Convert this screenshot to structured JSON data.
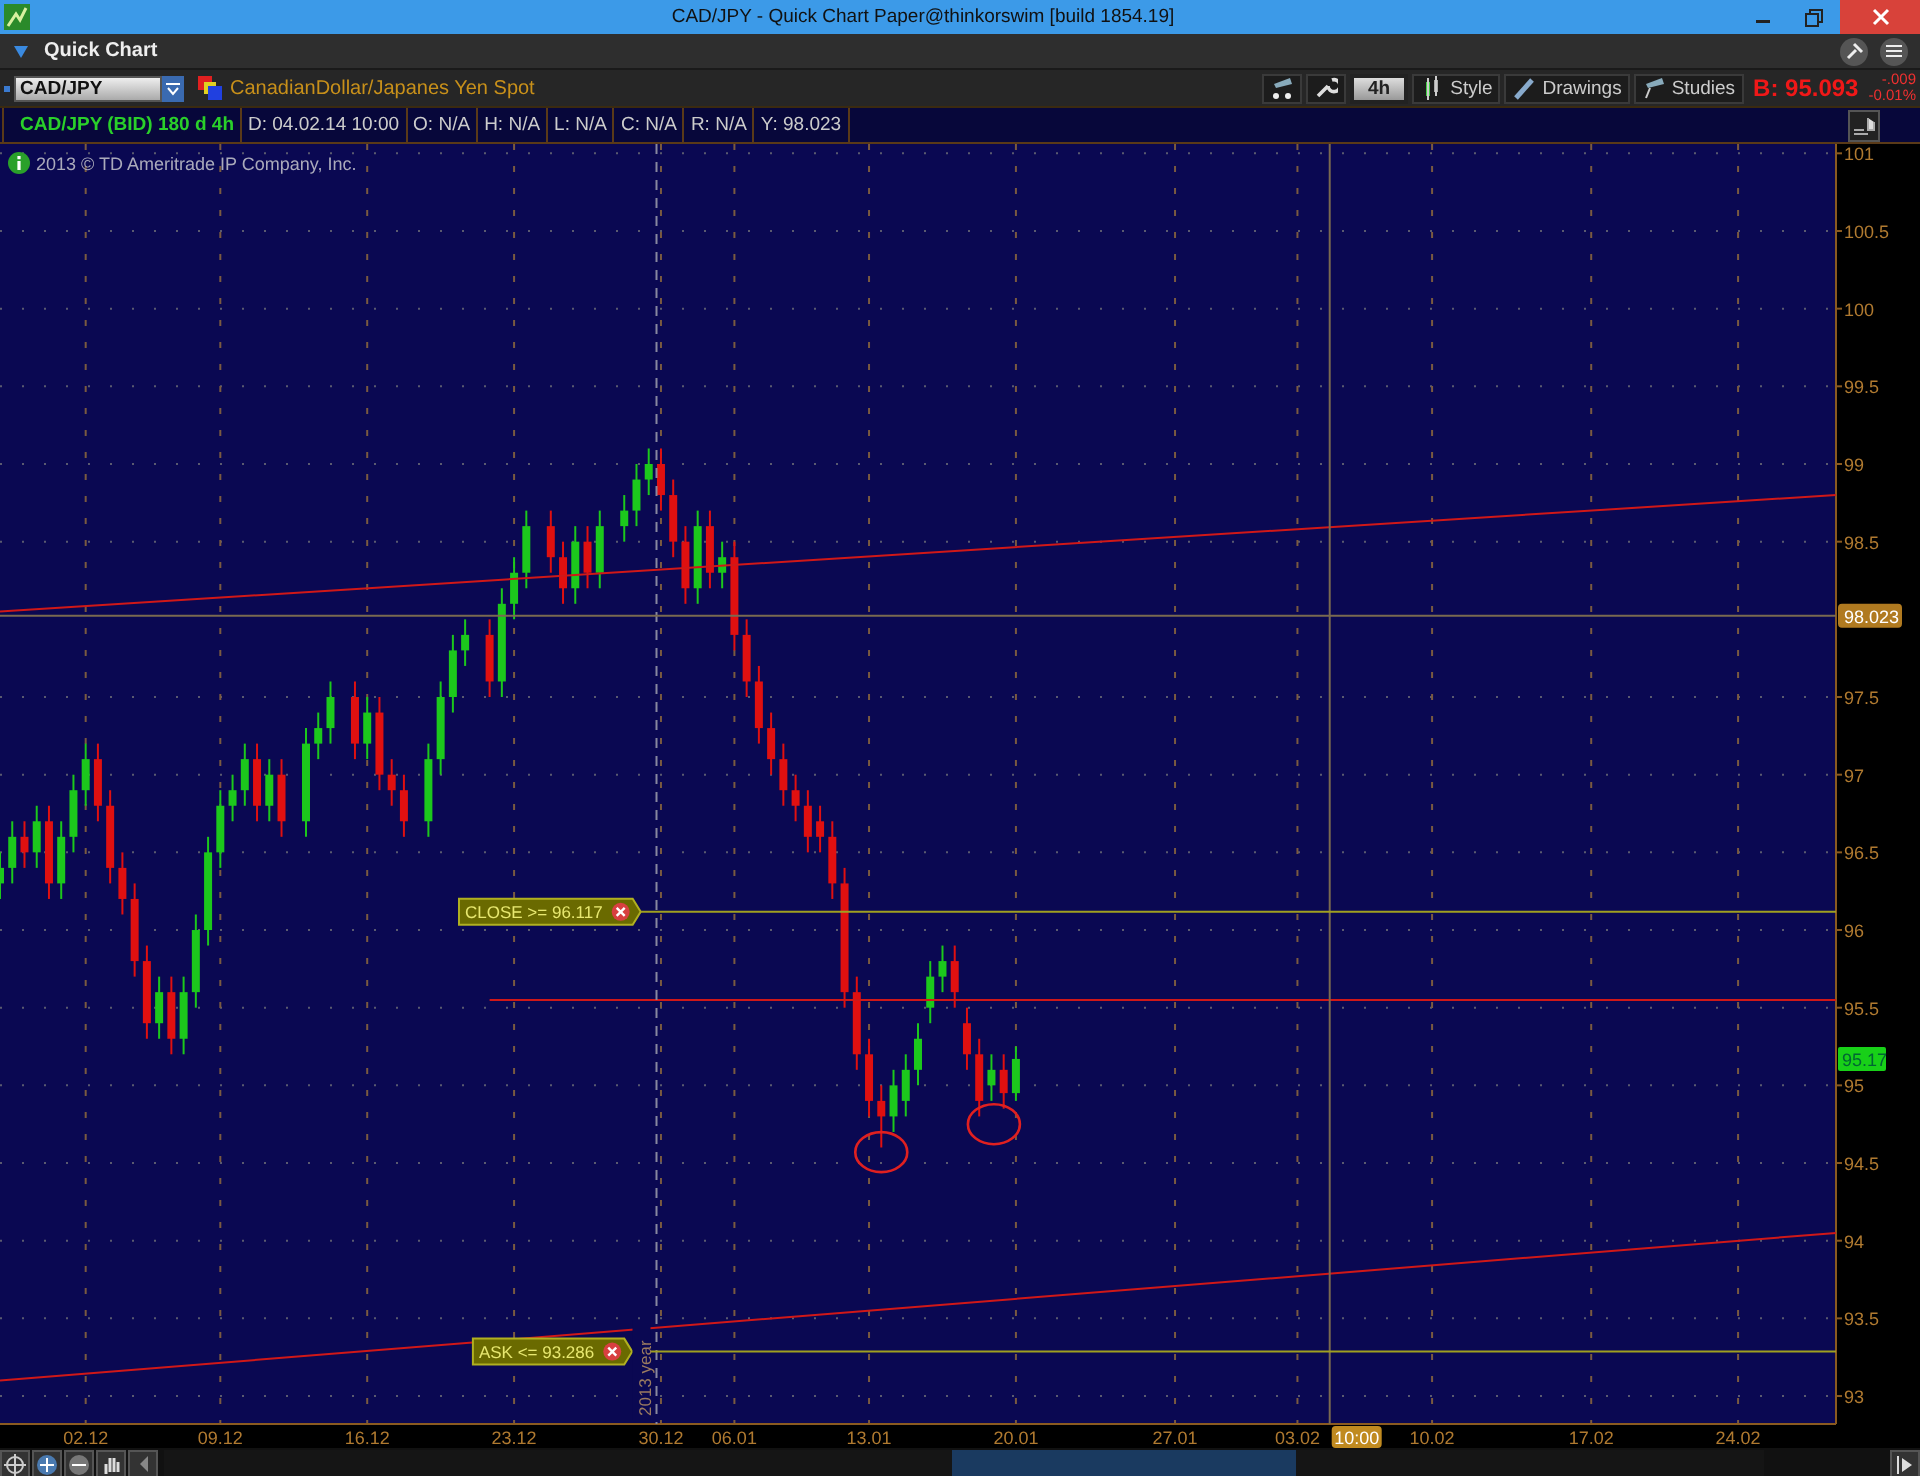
{
  "window": {
    "title": "CAD/JPY - Quick Chart Paper@thinkorswim [build 1854.19]"
  },
  "panel": {
    "title": "Quick Chart"
  },
  "toolbar": {
    "symbol": "CAD/JPY",
    "description": "CanadianDollar/Japanes Yen Spot",
    "timeframe": "4h",
    "buttons": [
      "Style",
      "Drawings",
      "Studies"
    ],
    "bid": "B: 95.093",
    "change": "-.009",
    "change_percent": "-0.01%"
  },
  "info_row": [
    "CAD/JPY (BID) 180 d 4h",
    "D: 04.02.14 10:00",
    "O: N/A",
    "H: N/A",
    "L: N/A",
    "C: N/A",
    "R: N/A",
    "Y: 98.023"
  ],
  "copyright": "2013 © TD Ameritrade IP Company, Inc.",
  "chart_data": {
    "type": "candlestick",
    "grid": true,
    "ylim": [
      92.82,
      101.06
    ],
    "yticks": [
      93,
      93.5,
      94,
      94.5,
      95,
      95.5,
      96,
      96.5,
      97,
      97.5,
      98.5,
      99,
      99.5,
      100,
      100.5,
      101
    ],
    "categories": [
      null,
      null,
      null,
      null,
      null,
      null,
      null,
      "02.12",
      null,
      null,
      null,
      null,
      null,
      null,
      null,
      null,
      null,
      null,
      "09.12",
      null,
      null,
      null,
      null,
      null,
      null,
      null,
      null,
      null,
      null,
      null,
      "16.12",
      null,
      null,
      null,
      null,
      null,
      null,
      null,
      null,
      null,
      null,
      null,
      "23.12",
      null,
      null,
      null,
      null,
      null,
      null,
      null,
      null,
      null,
      null,
      null,
      "30.12",
      null,
      null,
      null,
      null,
      null,
      "06.01",
      null,
      null,
      null,
      null,
      null,
      null,
      null,
      null,
      null,
      null,
      "13.01",
      null,
      null,
      null,
      null,
      null,
      null,
      null,
      null,
      null,
      null,
      null,
      "20.01",
      null,
      null,
      null,
      null,
      null,
      null,
      null,
      null,
      null,
      null,
      null,
      null,
      "27.01",
      null,
      null,
      null,
      null,
      null,
      null,
      null,
      null,
      null,
      "03.02",
      null,
      null,
      null,
      null,
      null,
      null,
      null,
      null,
      null,
      null,
      "10.02",
      null,
      null,
      null,
      null,
      null,
      null,
      null,
      null,
      null,
      null,
      null,
      null,
      "17.02",
      null,
      null,
      null,
      null,
      null,
      null,
      null,
      null,
      null,
      null,
      null,
      "24.02",
      null,
      null,
      null,
      null,
      null,
      null,
      null
    ],
    "ohlc": [
      [
        96.3,
        96.5,
        96.2,
        96.4
      ],
      [
        96.4,
        96.7,
        96.3,
        96.6
      ],
      [
        96.6,
        96.7,
        96.4,
        96.5
      ],
      [
        96.5,
        96.8,
        96.4,
        96.7
      ],
      [
        96.7,
        96.8,
        96.2,
        96.3
      ],
      [
        96.3,
        96.7,
        96.2,
        96.6
      ],
      [
        96.6,
        97.0,
        96.5,
        96.9
      ],
      [
        96.9,
        97.2,
        96.8,
        97.1
      ],
      [
        97.1,
        97.2,
        96.7,
        96.8
      ],
      [
        96.8,
        96.9,
        96.3,
        96.4
      ],
      [
        96.4,
        96.5,
        96.1,
        96.2
      ],
      [
        96.2,
        96.3,
        95.7,
        95.8
      ],
      [
        95.8,
        95.9,
        95.3,
        95.4
      ],
      [
        95.4,
        95.7,
        95.3,
        95.6
      ],
      [
        95.6,
        95.7,
        95.2,
        95.3
      ],
      [
        95.3,
        95.7,
        95.2,
        95.6
      ],
      [
        95.6,
        96.1,
        95.5,
        96.0
      ],
      [
        96.0,
        96.6,
        95.9,
        96.5
      ],
      [
        96.5,
        96.9,
        96.4,
        96.8
      ],
      [
        96.8,
        97.0,
        96.7,
        96.9
      ],
      [
        96.9,
        97.2,
        96.8,
        97.1
      ],
      [
        97.1,
        97.2,
        96.7,
        96.8
      ],
      [
        96.8,
        97.1,
        96.7,
        97.0
      ],
      [
        97.0,
        97.1,
        96.6,
        96.7
      ],
      null,
      [
        96.7,
        97.3,
        96.6,
        97.2
      ],
      [
        97.2,
        97.4,
        97.1,
        97.3
      ],
      [
        97.3,
        97.6,
        97.2,
        97.5
      ],
      null,
      [
        97.5,
        97.6,
        97.1,
        97.2
      ],
      [
        97.2,
        97.5,
        97.1,
        97.4
      ],
      [
        97.4,
        97.5,
        96.9,
        97.0
      ],
      [
        97.0,
        97.1,
        96.8,
        96.9
      ],
      [
        96.9,
        97.0,
        96.6,
        96.7
      ],
      null,
      [
        96.7,
        97.2,
        96.6,
        97.1
      ],
      [
        97.1,
        97.6,
        97.0,
        97.5
      ],
      [
        97.5,
        97.9,
        97.4,
        97.8
      ],
      [
        97.8,
        98.0,
        97.7,
        97.9
      ],
      null,
      [
        97.9,
        98.0,
        97.5,
        97.6
      ],
      [
        97.6,
        98.2,
        97.5,
        98.1
      ],
      [
        98.1,
        98.4,
        98.0,
        98.3
      ],
      [
        98.3,
        98.7,
        98.2,
        98.6
      ],
      null,
      [
        98.6,
        98.7,
        98.3,
        98.4
      ],
      [
        98.4,
        98.5,
        98.1,
        98.2
      ],
      [
        98.2,
        98.6,
        98.1,
        98.5
      ],
      [
        98.5,
        98.6,
        98.2,
        98.3
      ],
      [
        98.3,
        98.7,
        98.2,
        98.6
      ],
      null,
      [
        98.6,
        98.8,
        98.5,
        98.7
      ],
      [
        98.7,
        99.0,
        98.6,
        98.9
      ],
      [
        98.9,
        99.1,
        98.8,
        99.0
      ],
      [
        99.0,
        99.1,
        98.7,
        98.8
      ],
      [
        98.8,
        98.9,
        98.4,
        98.5
      ],
      [
        98.5,
        98.6,
        98.1,
        98.2
      ],
      [
        98.2,
        98.7,
        98.1,
        98.6
      ],
      [
        98.6,
        98.7,
        98.2,
        98.3
      ],
      [
        98.3,
        98.5,
        98.2,
        98.4
      ],
      [
        98.4,
        98.5,
        97.8,
        97.9
      ],
      [
        97.9,
        98.0,
        97.5,
        97.6
      ],
      [
        97.6,
        97.7,
        97.2,
        97.3
      ],
      [
        97.3,
        97.4,
        97.0,
        97.1
      ],
      [
        97.1,
        97.2,
        96.8,
        96.9
      ],
      [
        96.9,
        97.0,
        96.7,
        96.8
      ],
      [
        96.8,
        96.9,
        96.5,
        96.6
      ],
      [
        96.7,
        96.8,
        96.5,
        96.6
      ],
      [
        96.6,
        96.7,
        96.2,
        96.3
      ],
      [
        96.3,
        96.4,
        95.5,
        95.6
      ],
      [
        95.6,
        95.7,
        95.1,
        95.2
      ],
      [
        95.2,
        95.3,
        94.8,
        94.9
      ],
      [
        94.9,
        95.0,
        94.6,
        94.8
      ],
      [
        94.8,
        95.1,
        94.7,
        95.0
      ],
      [
        94.9,
        95.2,
        94.8,
        95.1
      ],
      [
        95.1,
        95.4,
        95.0,
        95.3
      ],
      [
        95.5,
        95.8,
        95.4,
        95.7
      ],
      [
        95.7,
        95.9,
        95.6,
        95.8
      ],
      [
        95.8,
        95.9,
        95.5,
        95.6
      ],
      [
        95.4,
        95.5,
        95.1,
        95.2
      ],
      [
        95.2,
        95.3,
        94.8,
        94.9
      ],
      [
        95.0,
        95.2,
        94.9,
        95.1
      ],
      [
        95.1,
        95.2,
        94.85,
        94.95
      ],
      [
        94.95,
        95.25,
        94.9,
        95.17
      ],
      null,
      null,
      null,
      null,
      null,
      null,
      null,
      null,
      null,
      null,
      null,
      null,
      null,
      null,
      null,
      null,
      null,
      null,
      null,
      null,
      null,
      null,
      null,
      null,
      null,
      null,
      null,
      null,
      null,
      null,
      null,
      null,
      null,
      null,
      null,
      null,
      null,
      null,
      null,
      null,
      null,
      null,
      null,
      null,
      null,
      null,
      null,
      null,
      null,
      null,
      null,
      null,
      null,
      null,
      null,
      null,
      null,
      null,
      null,
      null,
      null,
      null,
      null,
      null,
      null,
      null
    ]
  },
  "drawings": [
    {
      "kind": "trendline"
    },
    {
      "kind": "trendline"
    },
    {
      "kind": "hline"
    },
    {
      "kind": "alert",
      "label": "CLOSE >= 96.117"
    },
    {
      "kind": "alert",
      "label": "ASK <= 93.286"
    },
    {
      "kind": "separator",
      "label": "2013 year"
    },
    {
      "kind": "ellipse"
    },
    {
      "kind": "ellipse"
    },
    {
      "kind": "cursor",
      "time_label": "10:00",
      "price_label": "98.023"
    },
    {
      "kind": "last_price",
      "label": "95.17"
    }
  ]
}
